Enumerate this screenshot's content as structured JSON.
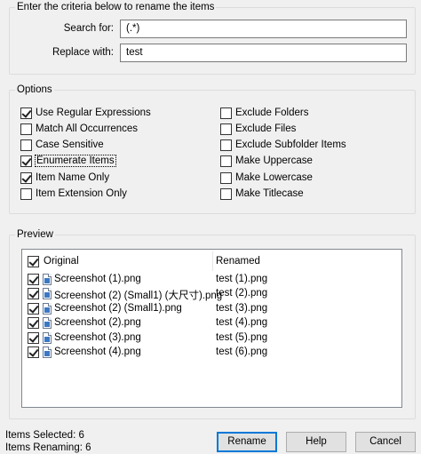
{
  "criteria": {
    "title": "Enter the criteria below to rename the items",
    "search_label": "Search for:",
    "search_value": "(.*)",
    "replace_label": "Replace with:",
    "replace_value": "test"
  },
  "options": {
    "title": "Options",
    "left": [
      {
        "label": "Use Regular Expressions",
        "checked": true
      },
      {
        "label": "Match All Occurrences",
        "checked": false
      },
      {
        "label": "Case Sensitive",
        "checked": false
      },
      {
        "label": "Enumerate Items",
        "checked": true
      },
      {
        "label": "Item Name Only",
        "checked": true
      },
      {
        "label": "Item Extension Only",
        "checked": false
      }
    ],
    "right": [
      {
        "label": "Exclude Folders",
        "checked": false
      },
      {
        "label": "Exclude Files",
        "checked": false
      },
      {
        "label": "Exclude Subfolder Items",
        "checked": false
      },
      {
        "label": "Make Uppercase",
        "checked": false
      },
      {
        "label": "Make Lowercase",
        "checked": false
      },
      {
        "label": "Make Titlecase",
        "checked": false
      }
    ]
  },
  "preview": {
    "title": "Preview",
    "col_original": "Original",
    "col_renamed": "Renamed",
    "header_checked": true,
    "rows": [
      {
        "original": "Screenshot (1).png",
        "renamed": "test (1).png",
        "checked": true
      },
      {
        "original": "Screenshot (2) (Small1) (大尺寸).png",
        "renamed": "test (2).png",
        "checked": true
      },
      {
        "original": "Screenshot (2) (Small1).png",
        "renamed": "test (3).png",
        "checked": true
      },
      {
        "original": "Screenshot (2).png",
        "renamed": "test (4).png",
        "checked": true
      },
      {
        "original": "Screenshot (3).png",
        "renamed": "test (5).png",
        "checked": true
      },
      {
        "original": "Screenshot (4).png",
        "renamed": "test (6).png",
        "checked": true
      }
    ]
  },
  "status": {
    "selected": "Items Selected: 6",
    "renaming": "Items Renaming: 6"
  },
  "buttons": {
    "rename": "Rename",
    "help": "Help",
    "cancel": "Cancel"
  }
}
